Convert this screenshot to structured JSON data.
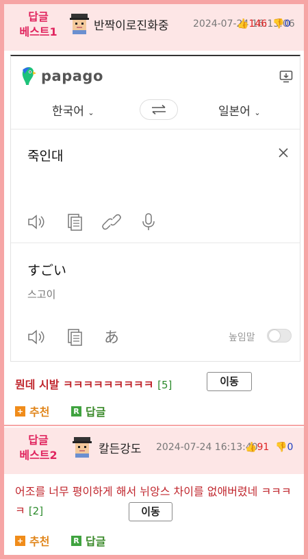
{
  "best1": {
    "label_line1": "답글",
    "label_line2": "베스트1",
    "nickname": "반짝이로진화중",
    "date": "2024-07-24 16:13:06",
    "up": "146",
    "down": "0"
  },
  "papago": {
    "logo_text": "papago",
    "source_lang": "한국어",
    "target_lang": "일본어",
    "source_text": "죽인대",
    "target_text": "すごい",
    "pronunciation": "스고이",
    "honorific_label": "높임말",
    "icons": [
      "monitor-icon",
      "speaker-icon",
      "copy-icon",
      "link-icon",
      "mic-icon",
      "close-icon",
      "hiragana-icon"
    ]
  },
  "comment1": {
    "text": "뭔데 시발 ㅋㅋㅋㅋㅋㅋㅋㅋㅋ",
    "reply_count": "[5]",
    "move_label": "이동",
    "recommend_label": "추천",
    "reply_label": "답글",
    "recommend_icon_glyph": "+",
    "reply_icon_glyph": "R"
  },
  "best2": {
    "label_line1": "답글",
    "label_line2": "베스트2",
    "nickname": "칼든강도",
    "date": "2024-07-24 16:13:40",
    "up": "91",
    "down": "0"
  },
  "comment2": {
    "text": "어조를 너무 평이하게 해서 뉘앙스 차이를 없애버렸네 ㅋㅋㅋㅋ",
    "reply_count": "[2]",
    "move_label": "이동",
    "recommend_label": "추천",
    "reply_label": "답글",
    "recommend_icon_glyph": "+",
    "reply_icon_glyph": "R"
  },
  "colors": {
    "frame": "#f6a5a5",
    "header_bg": "#fde6e6",
    "best_label": "#e0245e",
    "comment_red": "#c0262d",
    "recommend_orange": "#f08c1a",
    "reply_green": "#3fa33f",
    "papago_green": "#1ec27a"
  }
}
